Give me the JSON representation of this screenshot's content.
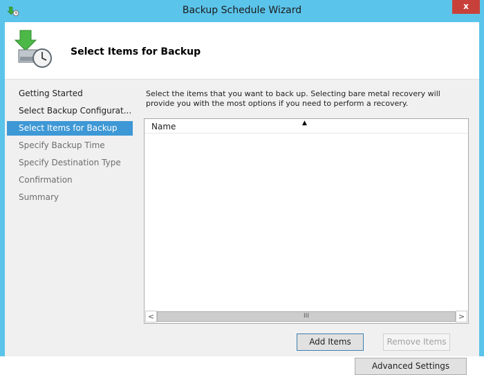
{
  "window": {
    "title": "Backup Schedule Wizard",
    "close_label": "x"
  },
  "header": {
    "title": "Select Items for Backup"
  },
  "nav": {
    "items": [
      {
        "label": "Getting Started",
        "state": "done"
      },
      {
        "label": "Select Backup Configurat...",
        "state": "done"
      },
      {
        "label": "Select Items for Backup",
        "state": "current"
      },
      {
        "label": "Specify Backup Time",
        "state": "future"
      },
      {
        "label": "Specify Destination Type",
        "state": "future"
      },
      {
        "label": "Confirmation",
        "state": "future"
      },
      {
        "label": "Summary",
        "state": "future"
      }
    ]
  },
  "main": {
    "description": "Select the items that you want to back up. Selecting bare metal recovery will provide you with the most options if you need to perform a recovery.",
    "list": {
      "column_name": "Name",
      "sort_glyph": "▲",
      "scroll_left": "<",
      "scroll_right": ">",
      "scroll_grip": "III"
    },
    "buttons": {
      "add_items": "Add Items",
      "remove_items": "Remove Items",
      "advanced_settings": "Advanced Settings"
    }
  },
  "colors": {
    "accent": "#3e98d5",
    "titlebar": "#5bc4ea",
    "close": "#c7413a"
  }
}
